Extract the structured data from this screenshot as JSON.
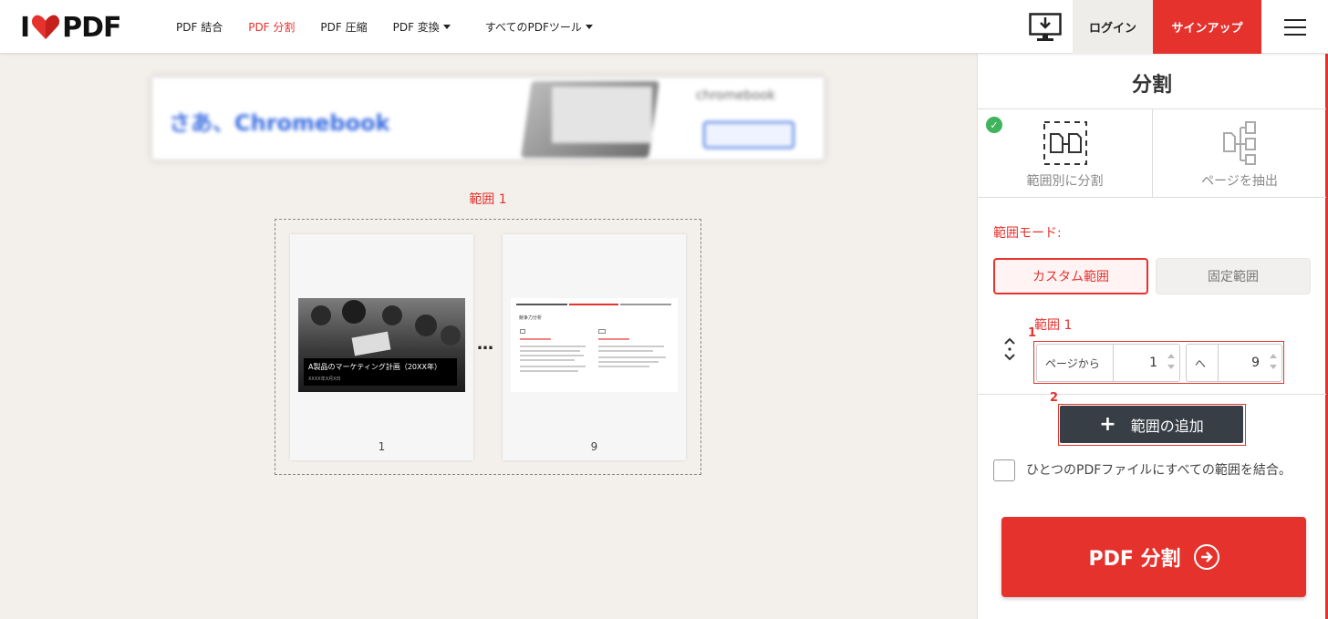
{
  "header": {
    "logo": {
      "left": "I",
      "right": "PDF"
    },
    "nav": [
      {
        "label": "PDF 結合"
      },
      {
        "label": "PDF 分割"
      },
      {
        "label": "PDF 圧縮"
      },
      {
        "label": "PDF 変換"
      },
      {
        "label": "すべてのPDFツール"
      }
    ],
    "login_label": "ログイン",
    "signup_label": "サインアップ"
  },
  "ad": {
    "headline": "さあ、Chromebook",
    "brand": "chromebook"
  },
  "workspace": {
    "range_title": "範囲 1",
    "pages": [
      {
        "number": "1",
        "caption": "A製品のマーケティング計画（20XX年）",
        "sub": "XXXX年X月X日"
      },
      {
        "number": "9",
        "heading": "競争力分析"
      }
    ],
    "ellipsis": "…"
  },
  "sidebar": {
    "title": "分割",
    "tabs": [
      {
        "label": "範囲別に分割"
      },
      {
        "label": "ページを抽出"
      }
    ],
    "range_mode_label": "範囲モード:",
    "mode_buttons": {
      "custom": "カスタム範囲",
      "fixed": "固定範囲"
    },
    "range": {
      "label": "範囲 1",
      "from_prefix": "ページから",
      "from_value": "1",
      "to_prefix": "へ",
      "to_value": "9"
    },
    "markers": {
      "one": "1",
      "two": "2"
    },
    "add_range_label": "範囲の追加",
    "merge_label": "ひとつのPDFファイルにすべての範囲を結合。",
    "split_button_label": "PDF 分割"
  },
  "colors": {
    "accent": "#e5322d",
    "dark_button": "#383e45",
    "success": "#40b45c"
  }
}
